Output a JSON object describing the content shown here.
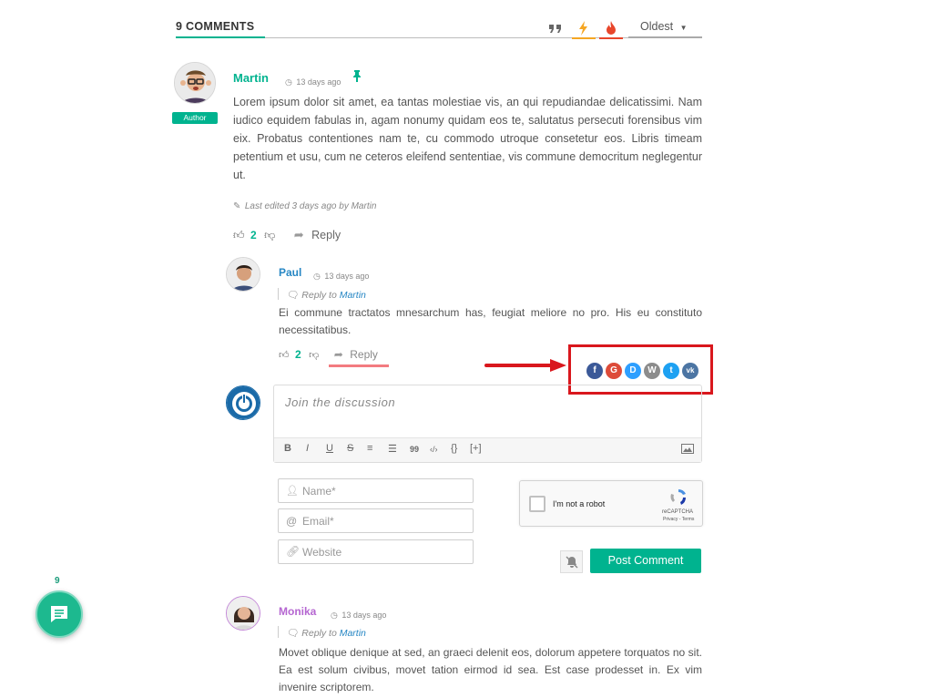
{
  "header": {
    "comments_count": "9 COMMENTS",
    "sort_selected": "Oldest"
  },
  "colors": {
    "accent": "#00b38f",
    "link": "#2787c4",
    "monika_name": "#b566d1",
    "annotation_red": "#d9171d"
  },
  "comments": [
    {
      "author": "Martin",
      "time": "13 days ago",
      "badge": "Author",
      "text": "Lorem ipsum dolor sit amet, ea tantas molestiae vis, an qui repudiandae delicatissimi. Nam iudico equidem fabulas in, agam nonumy quidam eos te, salutatus persecuti forensibus vim eix. Probatus contentiones nam te, cu commodo utroque consetetur eos. Libris timeam petentium et usu, cum ne ceteros eleifend sententiae, vis commune democritum neglegentur ut.",
      "edited": "Last edited 3 days ago by Martin",
      "votes": "2",
      "reply_label": "Reply"
    },
    {
      "author": "Paul",
      "time": "13 days ago",
      "reply_to_prefix": "Reply to",
      "reply_to": "Martin",
      "text": "Ei commune tractatos mnesarchum has, feugiat meliore no pro. His eu constituto necessitatibus.",
      "votes": "2",
      "reply_label": "Reply"
    },
    {
      "author": "Monika",
      "time": "13 days ago",
      "reply_to_prefix": "Reply to",
      "reply_to": "Martin",
      "text": "Movet oblique denique at sed, an graeci delenit eos, dolorum appetere torquatos no sit. Ea est solum civibus, movet tation eirmod id sea. Est case prodesset in. Ex vim invenire scriptorem."
    }
  ],
  "share_icons": [
    "facebook-icon",
    "google-icon",
    "disqus-icon",
    "wordpress-icon",
    "twitter-icon",
    "vk-icon"
  ],
  "form": {
    "editor_placeholder": "Join the discussion",
    "name_placeholder": "Name*",
    "email_placeholder": "Email*",
    "website_placeholder": "Website",
    "captcha_label": "I'm not a robot",
    "captcha_brand": "reCAPTCHA",
    "captcha_terms": "Privacy - Terms",
    "post_button": "Post Comment"
  },
  "toolbar": [
    "B",
    "I",
    "U",
    "S",
    "≡",
    "☰",
    "99",
    "‹/›",
    "{}",
    "[+]"
  ],
  "floating": {
    "count": "9"
  }
}
